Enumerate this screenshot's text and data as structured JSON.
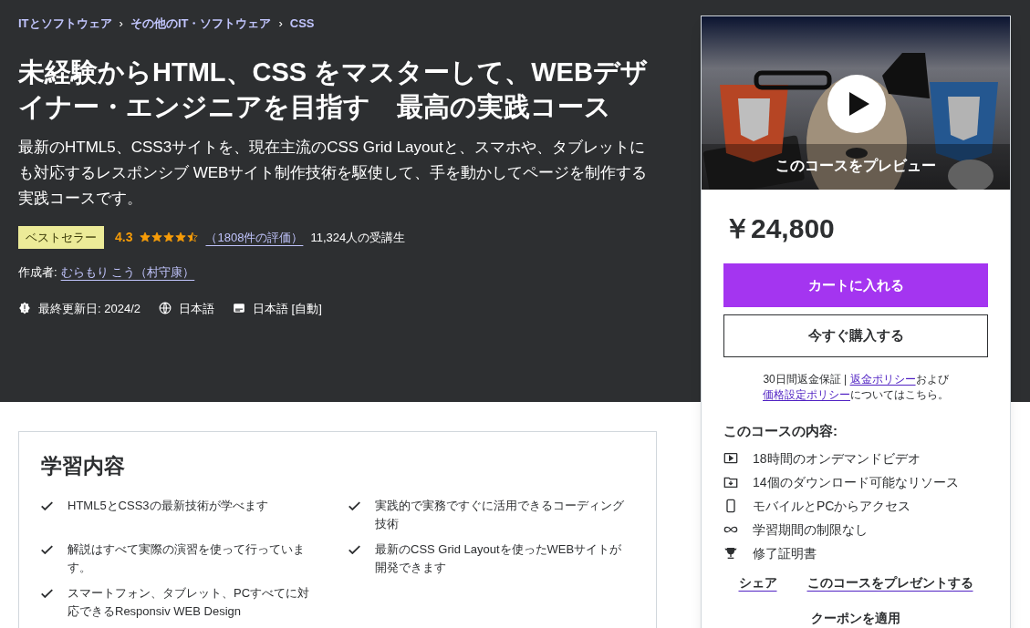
{
  "breadcrumbs": [
    "ITとソフトウェア",
    "その他のIT・ソフトウェア",
    "CSS"
  ],
  "breadcrumb_separator": "›",
  "title": "未経験からHTML、CSS をマスターして、WEBデザイナー・エンジニアを目指す　最高の実践コース",
  "subtitle": "最新のHTML5、CSS3サイトを、現在主流のCSS Grid Layoutと、スマホや、タブレットにも対応するレスポンシブ WEBサイト制作技術を駆使して、手を動かしてページを制作する実践コースです。",
  "badge": "ベストセラー",
  "rating": {
    "value": "4.3",
    "stars": 4.5,
    "count": "（1808件の評価）",
    "students": "11,324人の受講生"
  },
  "author": {
    "label": "作成者:",
    "name": "むらもり こう（村守康）"
  },
  "meta": [
    {
      "kind": "updated",
      "text": "最終更新日: 2024/2"
    },
    {
      "kind": "language",
      "text": "日本語"
    },
    {
      "kind": "captions",
      "text": "日本語 [自動]"
    }
  ],
  "learn": {
    "heading": "学習内容",
    "items": [
      {
        "text": "HTML5とCSS3の最新技術が学べます"
      },
      {
        "text": "実践的で実務ですぐに活用できるコーディング技術"
      },
      {
        "text": "解説はすべて実際の演習を使って行っています。"
      },
      {
        "text": "最新のCSS Grid Layoutを使ったWEBサイトが開発できます"
      },
      {
        "text": "スマートフォン、タブレット、PCすべてに対応できるResponsiv WEB Design"
      }
    ]
  },
  "preview": {
    "kind": "picture",
    "label": "このコースをプレビュー"
  },
  "price": "￥24,800",
  "buttons": [
    {
      "kind": "primary",
      "label": "カートに入れる"
    },
    {
      "kind": "outline",
      "label": "今すぐ購入する"
    }
  ],
  "guarantee": {
    "text": "30日間返金保証 | ",
    "link1": "返金ポリシー",
    "mid": "および",
    "link2": "価格設定ポリシー",
    "end": "についてはこちら。"
  },
  "includes": {
    "heading": "このコースの内容:",
    "items": [
      {
        "kind": "video",
        "text": "18時間のオンデマンドビデオ"
      },
      {
        "kind": "download",
        "text": "14個のダウンロード可能なリソース"
      },
      {
        "kind": "mobile",
        "text": "モバイルとPCからアクセス"
      },
      {
        "kind": "infinity",
        "text": "学習期間の制限なし"
      },
      {
        "kind": "trophy",
        "text": "修了証明書"
      }
    ]
  },
  "actions": [
    "シェア",
    "このコースをプレゼントする"
  ],
  "coupon": "クーポンを適用"
}
